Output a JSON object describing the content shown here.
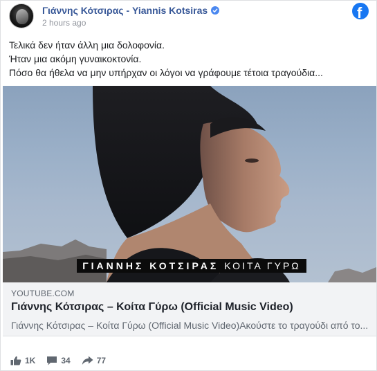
{
  "post": {
    "page_name": "Γιάννης Κότσιρας - Yiannis Kotsiras",
    "timestamp": "2 hours ago",
    "text_lines": [
      "Τελικά δεν ήταν άλλη μια δολοφονία.",
      "Ήταν μια ακόμη γυναικοκτονία.",
      "Πόσο θα ήθελα να μην υπήρχαν οι λόγοι να γράφουμε τέτοια τραγούδια..."
    ]
  },
  "media": {
    "overlay_artist": "ΓΙΑΝΝΗΣ ΚΟΤΣΙΡΑΣ",
    "overlay_song": "ΚΟΙΤΑ ΓΥΡΩ"
  },
  "link": {
    "domain": "YOUTUBE.COM",
    "title": "Γιάννης Κότσιρας – Κοίτα Γύρω (Official Music Video)",
    "description": "Γιάννης Κότσιρας – Κοίτα Γύρω (Official Music Video)Ακούστε το τραγούδι από το..."
  },
  "actions": {
    "likes": "1K",
    "comments": "34",
    "shares": "77"
  },
  "icons": {
    "verified": "verified-badge-icon",
    "brand": "facebook-logo-icon",
    "like": "thumbs-up-icon",
    "comment": "comment-icon",
    "share": "share-arrow-icon"
  },
  "colors": {
    "page_name": "#385898",
    "facebook_blue": "#1877f2",
    "verified_blue": "#4b88f0",
    "muted_text": "#606770"
  }
}
